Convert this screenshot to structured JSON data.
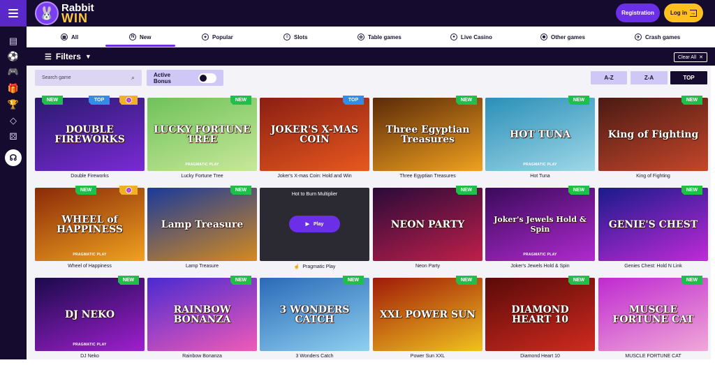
{
  "header": {
    "logo_top": "Rabbit",
    "logo_bottom": "WIN",
    "registration": "Registration",
    "login": "Log in"
  },
  "categories": [
    {
      "label": "All",
      "icon": "grid-icon"
    },
    {
      "label": "New",
      "icon": "new-icon"
    },
    {
      "label": "Popular",
      "icon": "popular-icon"
    },
    {
      "label": "Slots",
      "icon": "slots-icon"
    },
    {
      "label": "Table games",
      "icon": "table-games-icon"
    },
    {
      "label": "Live Casino",
      "icon": "live-casino-icon"
    },
    {
      "label": "Other games",
      "icon": "other-games-icon"
    },
    {
      "label": "Crash games",
      "icon": "crash-games-icon"
    }
  ],
  "active_category": "New",
  "filters": {
    "title": "Filters",
    "clear_all": "Clear All"
  },
  "search": {
    "placeholder": "Search game"
  },
  "active_bonus": {
    "label": "Active Bonus",
    "on": false
  },
  "sort": {
    "az": "A-Z",
    "za": "Z-A",
    "top": "TOP",
    "selected": "TOP"
  },
  "badges": {
    "new": "NEW",
    "top": "TOP"
  },
  "hover": {
    "title": "Hot to Burn Multiplier",
    "play": "Play",
    "caption": "Pragmatic Play"
  },
  "games": [
    {
      "name": "Double Fireworks",
      "art": "DOUBLE FIREWORKS",
      "provider": "",
      "colors": [
        "#2a1a6e",
        "#7a2ad6"
      ]
    },
    {
      "name": "Lucky Fortune Tree",
      "art": "LUCKY FORTUNE TREE",
      "provider": "PRAGMATIC PLAY",
      "colors": [
        "#6fc25a",
        "#c8e89a"
      ]
    },
    {
      "name": "Joker's X-mas Coin: Hold and Win",
      "art": "JOKER'S X-MAS COIN",
      "provider": "",
      "colors": [
        "#8a1f12",
        "#e8581f"
      ]
    },
    {
      "name": "Three Egyptian Treasures",
      "art": "Three Egyptian Treasures",
      "provider": "",
      "colors": [
        "#5b2a08",
        "#f0a11f"
      ]
    },
    {
      "name": "Hot Tuna",
      "art": "HOT TUNA",
      "provider": "PRAGMATIC PLAY",
      "colors": [
        "#2a8fb8",
        "#9fd8e8"
      ]
    },
    {
      "name": "King of Fighting",
      "art": "King of Fighting",
      "provider": "",
      "colors": [
        "#4a1a14",
        "#c5462a"
      ]
    },
    {
      "name": "Wheel of Happiness",
      "art": "WHEEL of HAPPINESS",
      "provider": "PRAGMATIC PLAY",
      "colors": [
        "#8a2a08",
        "#f0a21f"
      ]
    },
    {
      "name": "Lamp Treasure",
      "art": "Lamp Treasure",
      "provider": "",
      "colors": [
        "#1a3a9a",
        "#d48a1f"
      ]
    },
    {
      "name": "Pragmatic Play",
      "art": "",
      "provider": "",
      "colors": [
        "#2b2a33",
        "#2b2a33"
      ]
    },
    {
      "name": "Neon Party",
      "art": "NEON PARTY",
      "provider": "",
      "colors": [
        "#2a0a3a",
        "#c01f4a"
      ]
    },
    {
      "name": "Joker's Jewels Hold & Spin",
      "art": "Joker's Jewels Hold & Spin",
      "provider": "PRAGMATIC PLAY",
      "colors": [
        "#3a0a5a",
        "#b02ad0"
      ]
    },
    {
      "name": "Genies Chest: Hold N Link",
      "art": "GENIE'S CHEST",
      "provider": "",
      "colors": [
        "#1a1a8a",
        "#c02ad8"
      ]
    },
    {
      "name": "DJ Neko",
      "art": "DJ NEKO",
      "provider": "PRAGMATIC PLAY",
      "colors": [
        "#1a0a4a",
        "#a01fd0"
      ]
    },
    {
      "name": "Rainbow Bonanza",
      "art": "RAINBOW BONANZA",
      "provider": "",
      "colors": [
        "#4a2ad0",
        "#f05ab8"
      ]
    },
    {
      "name": "3 Wonders Catch",
      "art": "3 WONDERS CATCH",
      "provider": "",
      "colors": [
        "#2a6ab8",
        "#8fd0f0"
      ]
    },
    {
      "name": "Power Sun XXL",
      "art": "XXL POWER SUN",
      "provider": "",
      "colors": [
        "#a01a08",
        "#f0c21f"
      ]
    },
    {
      "name": "Diamond Heart 10",
      "art": "DIAMOND HEART 10",
      "provider": "",
      "colors": [
        "#5a0a08",
        "#d02a1f"
      ]
    },
    {
      "name": "MUSCLE FORTUNE CAT",
      "art": "MUSCLE FORTUNE CAT",
      "provider": "",
      "colors": [
        "#c02ad0",
        "#f0a8d8"
      ]
    }
  ]
}
